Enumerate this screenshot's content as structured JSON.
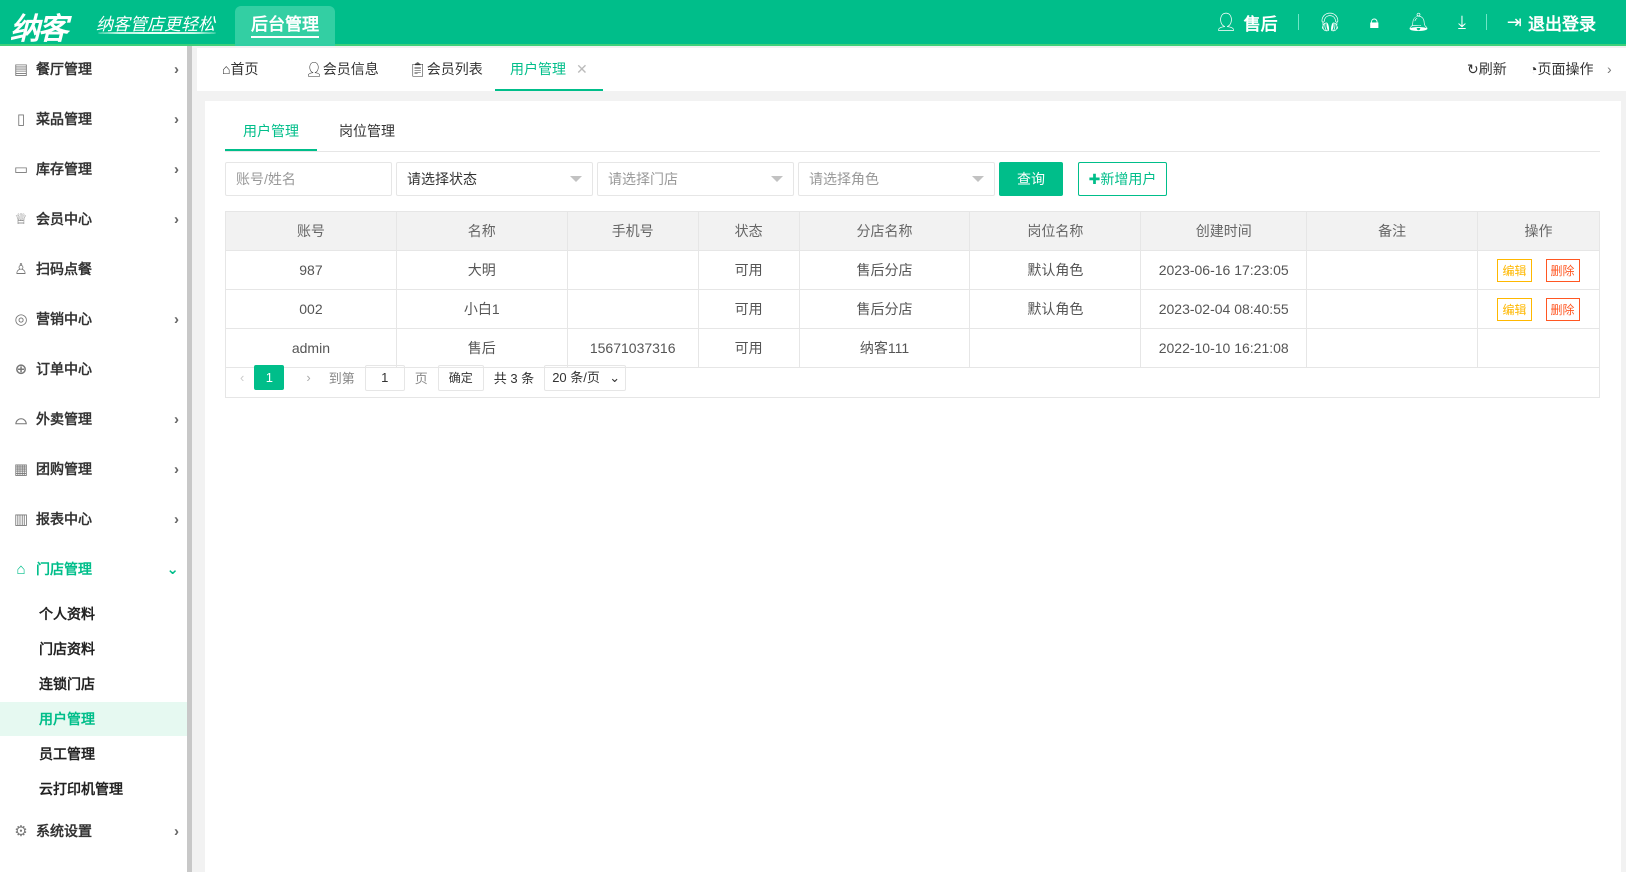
{
  "header": {
    "logo": "纳客",
    "slogan": "纳客管店更轻松",
    "system_tab": "后台管理",
    "user": "售后",
    "logout": "退出登录"
  },
  "sidebar": {
    "items": [
      {
        "label": "餐厅管理",
        "icon": "building-icon",
        "arrow": "›"
      },
      {
        "label": "菜品管理",
        "icon": "layout-icon",
        "arrow": "›"
      },
      {
        "label": "库存管理",
        "icon": "box-icon",
        "arrow": "›"
      },
      {
        "label": "会员中心",
        "icon": "crown-icon",
        "arrow": "›"
      },
      {
        "label": "扫码点餐",
        "icon": "user-icon",
        "arrow": ""
      },
      {
        "label": "营销中心",
        "icon": "target-icon",
        "arrow": "›"
      },
      {
        "label": "订单中心",
        "icon": "globe-icon",
        "arrow": ""
      },
      {
        "label": "外卖管理",
        "icon": "bell-dish-icon",
        "arrow": "›"
      },
      {
        "label": "团购管理",
        "icon": "calendar-icon",
        "arrow": "›"
      },
      {
        "label": "报表中心",
        "icon": "chart-icon",
        "arrow": "›"
      },
      {
        "label": "门店管理",
        "icon": "store-icon",
        "arrow": "⌄"
      }
    ],
    "sub_items": [
      "个人资料",
      "门店资料",
      "连锁门店",
      "用户管理",
      "员工管理",
      "云打印机管理"
    ],
    "settings": "系统设置"
  },
  "tabs": {
    "home": "首页",
    "member_info": "会员信息",
    "member_list": "会员列表",
    "user_mgmt": "用户管理",
    "refresh": "刷新",
    "page_ops": "页面操作"
  },
  "inner_tabs": [
    "用户管理",
    "岗位管理"
  ],
  "filters": {
    "account_placeholder": "账号/姓名",
    "status": "请选择状态",
    "store": "请选择门店",
    "role": "请选择角色",
    "query": "查询",
    "add": "✚新增用户"
  },
  "table": {
    "headers": [
      "账号",
      "名称",
      "手机号",
      "状态",
      "分店名称",
      "岗位名称",
      "创建时间",
      "备注",
      "操作"
    ],
    "rows": [
      [
        "987",
        "大明",
        "",
        "可用",
        "售后分店",
        "默认角色",
        "2023-06-16 17:23:05",
        ""
      ],
      [
        "002",
        "小白1",
        "",
        "可用",
        "售后分店",
        "默认角色",
        "2023-02-04 08:40:55",
        ""
      ],
      [
        "admin",
        "售后",
        "15671037316",
        "可用",
        "纳客111",
        "",
        "2022-10-10 16:21:08",
        ""
      ]
    ],
    "edit": "编辑",
    "delete": "删除"
  },
  "pager": {
    "current": "1",
    "goto": "到第",
    "page_input": "1",
    "page_unit": "页",
    "confirm": "确定",
    "total": "共 3 条",
    "page_size": "20 条/页"
  }
}
